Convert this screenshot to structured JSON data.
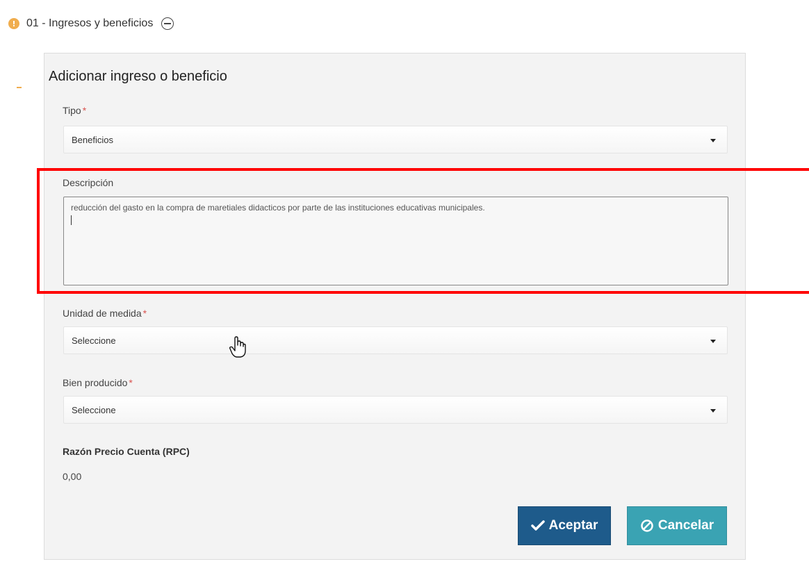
{
  "section": {
    "title": "01 - Ingresos y beneficios",
    "status_icon": "warning-icon",
    "toggle_icon": "minus-circle-icon"
  },
  "form": {
    "title": "Adicionar ingreso o beneficio",
    "tipo": {
      "label": "Tipo",
      "required_mark": "*",
      "selected": "Beneficios"
    },
    "descripcion": {
      "label": "Descripción",
      "value": "reducción del gasto en la compra de maretiales didacticos por parte de las instituciones educativas municipales."
    },
    "unidad": {
      "label": "Unidad de medida",
      "required_mark": "*",
      "selected": "Seleccione"
    },
    "bien": {
      "label": "Bien producido",
      "required_mark": "*",
      "selected": "Seleccione"
    },
    "rpc": {
      "label": "Razón Precio Cuenta (RPC)",
      "value": "0,00"
    },
    "buttons": {
      "accept": "Aceptar",
      "cancel": "Cancelar"
    }
  },
  "colors": {
    "accept": "#1e5b8b",
    "cancel": "#3aa3b3",
    "required": "#d9534f",
    "highlight": "#ff0000",
    "warning": "#f0ad4e"
  }
}
